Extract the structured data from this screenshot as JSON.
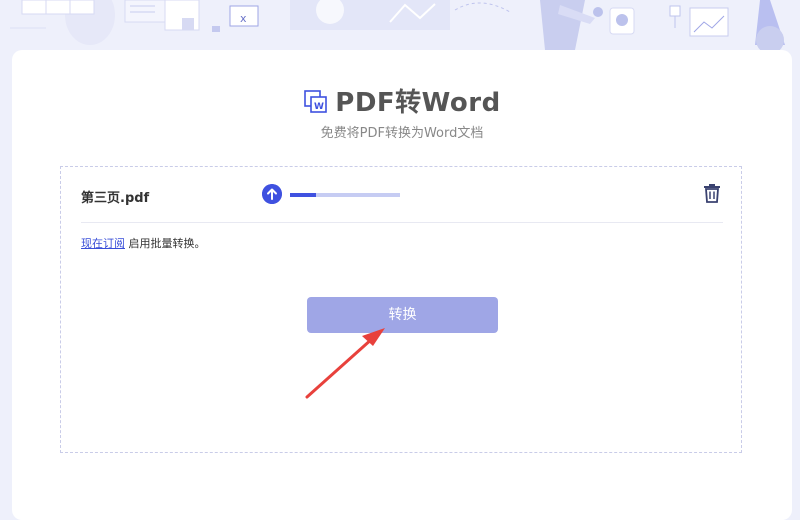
{
  "header": {
    "title": "PDF转Word",
    "subtitle": "免费将PDF转换为Word文档",
    "title_icon": "pdf-to-word-icon"
  },
  "upload": {
    "file_name": "第三页.pdf",
    "upload_icon": "upload-arrow-icon",
    "progress": 0.24,
    "delete_icon": "trash-icon"
  },
  "notice": {
    "link_text": "现在订阅",
    "text": " 启用批量转换。"
  },
  "actions": {
    "convert_label": "转换"
  },
  "colors": {
    "accent": "#3f51e0",
    "button": "#9fa6e6",
    "arrow": "#e8413c",
    "background": "#eef0fb"
  }
}
